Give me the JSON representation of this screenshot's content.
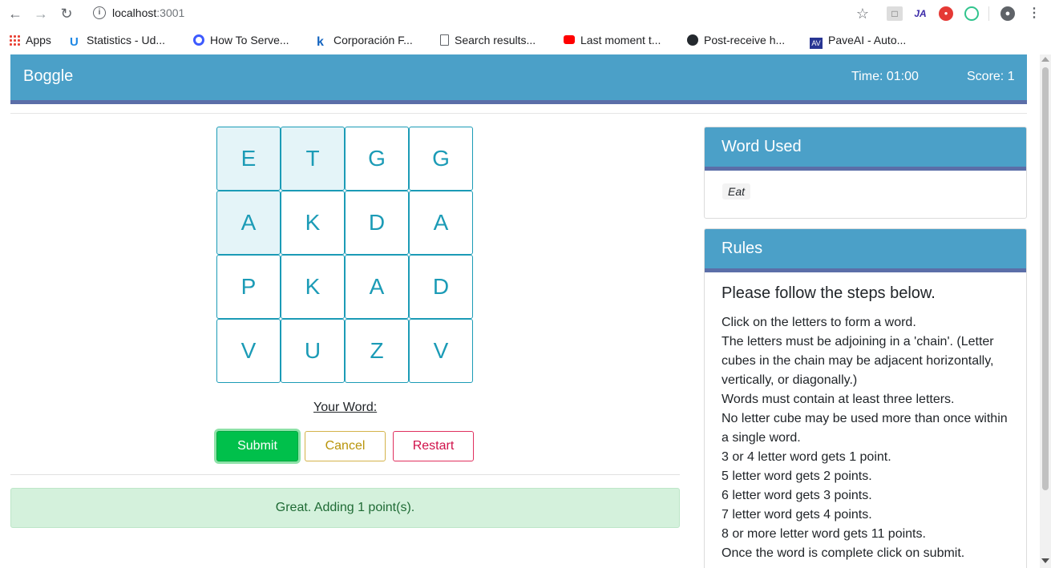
{
  "browser": {
    "url_host": "localhost",
    "url_port": ":3001",
    "bookmarks": [
      {
        "label": "Apps",
        "icon": "apps-grid-icon"
      },
      {
        "label": "Statistics - Ud...",
        "icon": "udemy-icon"
      },
      {
        "label": "How To Serve...",
        "icon": "digitalocean-icon"
      },
      {
        "label": "Corporación F...",
        "icon": "k-icon"
      },
      {
        "label": "Search results...",
        "icon": "document-icon"
      },
      {
        "label": "Last moment t...",
        "icon": "youtube-icon"
      },
      {
        "label": "Post-receive h...",
        "icon": "github-icon"
      },
      {
        "label": "PaveAI - Auto...",
        "icon": "paveai-icon"
      }
    ]
  },
  "header": {
    "brand": "Boggle",
    "time": "Time: 01:00",
    "score": "Score: 1"
  },
  "board": {
    "rows": [
      [
        "E",
        "T",
        "G",
        "G"
      ],
      [
        "A",
        "K",
        "D",
        "A"
      ],
      [
        "P",
        "K",
        "A",
        "D"
      ],
      [
        "V",
        "U",
        "Z",
        "V"
      ]
    ],
    "selected": [
      [
        0,
        0
      ],
      [
        0,
        1
      ],
      [
        1,
        0
      ]
    ]
  },
  "game": {
    "your_word_label": "Your Word:",
    "submit_label": "Submit",
    "cancel_label": "Cancel",
    "restart_label": "Restart",
    "message": "Great. Adding 1 point(s)."
  },
  "words_card": {
    "title": "Word Used",
    "words": [
      "Eat"
    ]
  },
  "rules_card": {
    "title": "Rules",
    "subtitle": "Please follow the steps below.",
    "items": [
      "Click on the letters to form a word.",
      "The letters must be adjoining in a 'chain'. (Letter cubes in the chain may be adjacent horizontally, vertically, or diagonally.)",
      "Words must contain at least three letters.",
      "No letter cube may be used more than once within a single word.",
      "3 or 4 letter word gets 1 point.",
      "5 letter word gets 2 points.",
      "6 letter word gets 3 points.",
      "7 letter word gets 4 points.",
      "8 or more letter word gets 11 points.",
      "Once the word is complete click on submit."
    ]
  },
  "colors": {
    "primary": "#4ba0c8",
    "accent_border": "#5b6ea8",
    "tile": "#1b9bb6",
    "success": "#00c04b",
    "warning": "#b8940a",
    "danger": "#d0114a"
  }
}
